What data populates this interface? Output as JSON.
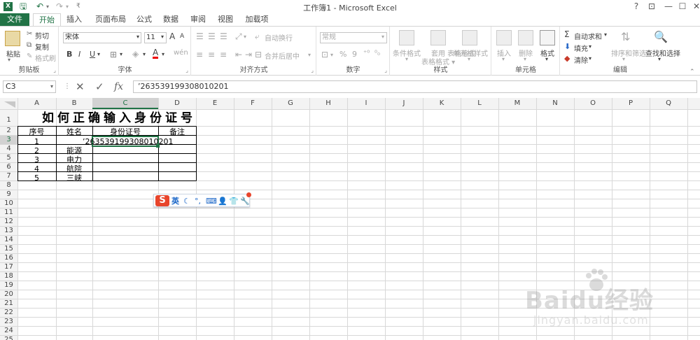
{
  "window": {
    "title": "工作簿1 - Microsoft Excel",
    "controls": [
      "?",
      "⊡",
      "—",
      "☐",
      "✕"
    ],
    "app_icon_letter": "X"
  },
  "tabs": [
    "文件",
    "开始",
    "插入",
    "页面布局",
    "公式",
    "数据",
    "审阅",
    "视图",
    "加载项"
  ],
  "ribbon": {
    "clipboard": {
      "paste": "粘贴",
      "cut": "剪切",
      "copy": "复制",
      "format_painter": "格式刷",
      "label": "剪贴板"
    },
    "font": {
      "name": "宋体",
      "size": "11",
      "bold": "B",
      "italic": "I",
      "underline": "U",
      "label": "字体",
      "grow": "A",
      "shrink": "A"
    },
    "alignment": {
      "wrap": "自动换行",
      "merge": "合并后居中",
      "label": "对齐方式"
    },
    "number": {
      "format": "常规",
      "percent": "%",
      "comma": "9",
      "label": "数字"
    },
    "styles": {
      "conditional": "条件格式",
      "table": "套用\n表格格式",
      "cell_styles": "单元格样式",
      "label": "样式"
    },
    "cells": {
      "insert": "插入",
      "delete": "删除",
      "format": "格式",
      "label": "单元格"
    },
    "editing": {
      "autosum": "自动求和",
      "fill": "填充",
      "clear": "清除",
      "sort": "排序和筛选",
      "find": "查找和选择",
      "label": "编辑"
    }
  },
  "formula_bar": {
    "name_box": "C3",
    "cancel": "✕",
    "enter": "✓",
    "fx": "fx",
    "content": "’263539199308010201"
  },
  "sheet": {
    "columns": [
      "A",
      "B",
      "C",
      "D",
      "E",
      "F",
      "G",
      "H",
      "I",
      "J",
      "K",
      "L",
      "M",
      "N",
      "O",
      "P",
      "Q"
    ],
    "rows": [
      "1",
      "2",
      "3",
      "4",
      "5",
      "6",
      "7",
      "8",
      "9",
      "10",
      "11",
      "12",
      "13",
      "14",
      "15",
      "16",
      "17",
      "18",
      "19",
      "20",
      "21",
      "22",
      "23",
      "24",
      "25"
    ],
    "title": "如何正确输入身份证号",
    "headers": [
      "序号",
      "姓名",
      "身份证号",
      "备注"
    ],
    "data": [
      [
        "1",
        "",
        "’263539199308010201",
        ""
      ],
      [
        "2",
        "能源",
        "",
        ""
      ],
      [
        "3",
        "电力",
        "",
        ""
      ],
      [
        "4",
        "航院",
        "",
        ""
      ],
      [
        "5",
        "三峡",
        "",
        ""
      ]
    ],
    "selected_cell": "C3"
  },
  "ime": {
    "logo": "S",
    "mode": "英"
  },
  "watermark": {
    "brand": "Baidu经验",
    "url": "jingyan.baidu.com"
  }
}
